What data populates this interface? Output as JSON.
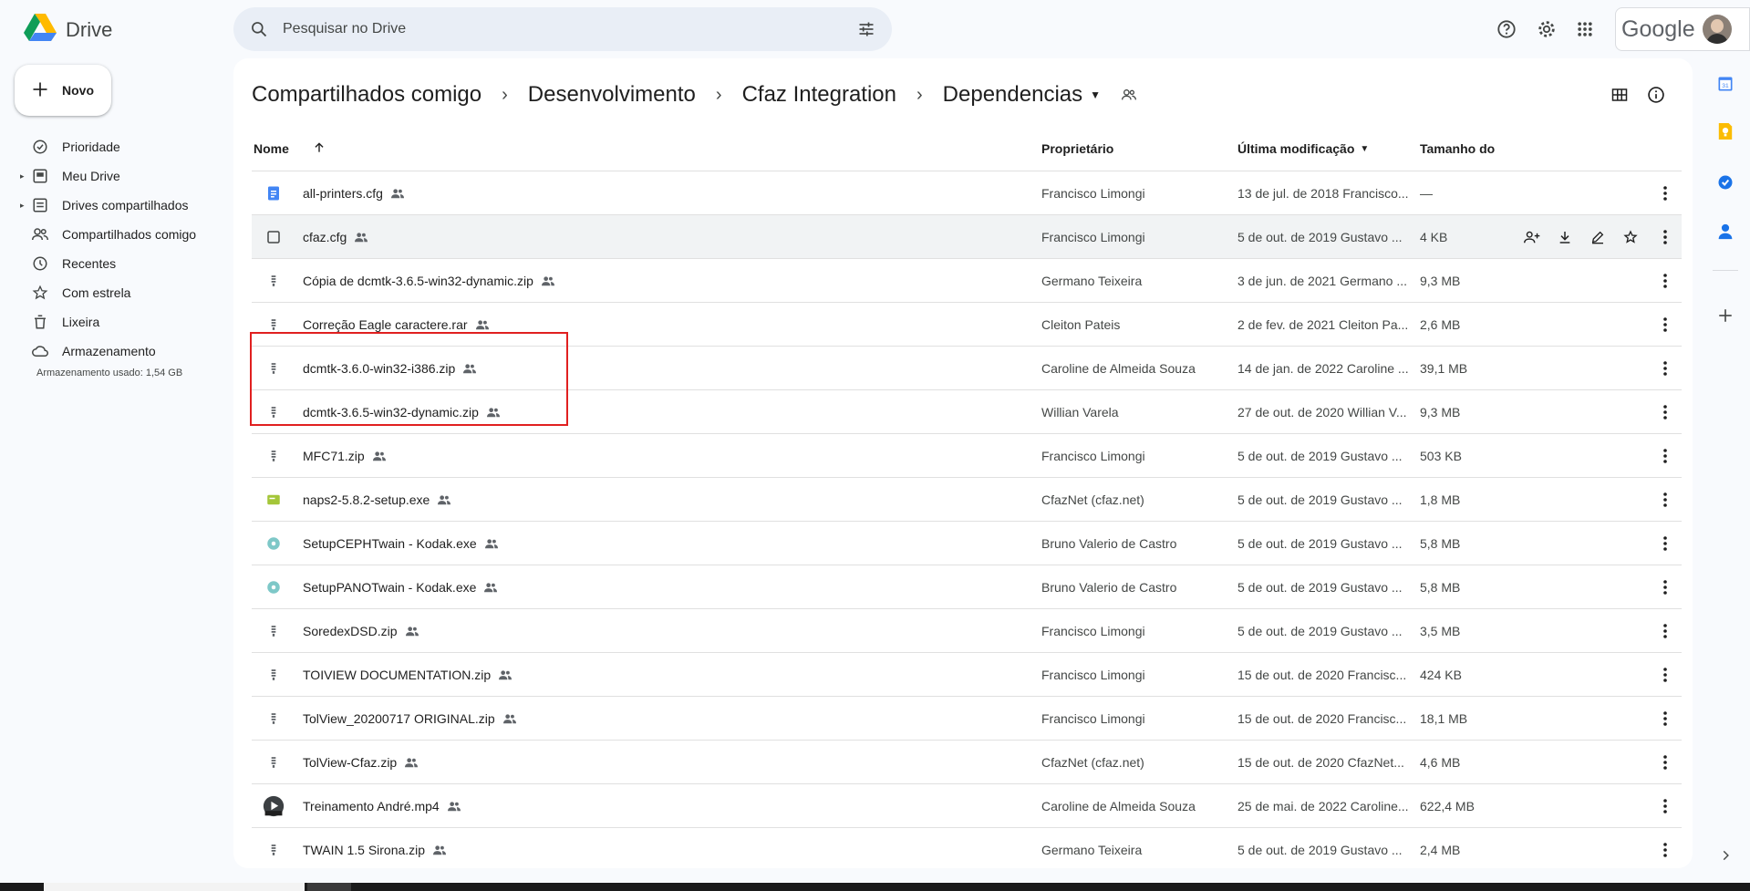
{
  "app": {
    "name": "Drive"
  },
  "search": {
    "placeholder": "Pesquisar no Drive"
  },
  "account": {
    "brand": "Google"
  },
  "sidebar": {
    "new_label": "Novo",
    "items": [
      {
        "label": "Prioridade",
        "icon": "priority-icon",
        "caret": false
      },
      {
        "label": "Meu Drive",
        "icon": "my-drive-icon",
        "caret": true
      },
      {
        "label": "Drives compartilhados",
        "icon": "shared-drives-icon",
        "caret": true
      },
      {
        "label": "Compartilhados comigo",
        "icon": "shared-with-me-icon",
        "caret": false
      },
      {
        "label": "Recentes",
        "icon": "clock-icon",
        "caret": false
      },
      {
        "label": "Com estrela",
        "icon": "star-icon",
        "caret": false
      },
      {
        "label": "Lixeira",
        "icon": "trash-icon",
        "caret": false
      },
      {
        "label": "Armazenamento",
        "icon": "cloud-icon",
        "caret": false
      }
    ],
    "storage_text": "Armazenamento usado: 1,54 GB"
  },
  "breadcrumb": [
    "Compartilhados comigo",
    "Desenvolvimento",
    "Cfaz Integration",
    "Dependencias"
  ],
  "table": {
    "headers": {
      "name": "Nome",
      "owner": "Proprietário",
      "modified": "Última modificação",
      "size": "Tamanho do"
    },
    "rows": [
      {
        "name": "all-printers.cfg",
        "icon": "doc-icon",
        "owner": "Francisco Limongi",
        "modified": "13 de jul. de 2018 Francisco...",
        "size": "—"
      },
      {
        "name": "cfaz.cfg",
        "icon": "checkbox-icon",
        "owner": "Francisco Limongi",
        "modified": "5 de out. de 2019 Gustavo ...",
        "size": "4 KB"
      },
      {
        "name": "Cópia de dcmtk-3.6.5-win32-dynamic.zip",
        "icon": "zip-icon",
        "owner": "Germano Teixeira",
        "modified": "3 de jun. de 2021 Germano ...",
        "size": "9,3 MB"
      },
      {
        "name": "Correção Eagle caractere.rar",
        "icon": "zip-icon",
        "owner": "Cleiton Pateis",
        "modified": "2 de fev. de 2021 Cleiton Pa...",
        "size": "2,6 MB"
      },
      {
        "name": "dcmtk-3.6.0-win32-i386.zip",
        "icon": "zip-icon",
        "owner": "Caroline de Almeida Souza",
        "modified": "14 de jan. de 2022 Caroline ...",
        "size": "39,1 MB"
      },
      {
        "name": "dcmtk-3.6.5-win32-dynamic.zip",
        "icon": "zip-icon",
        "owner": "Willian Varela",
        "modified": "27 de out. de 2020 Willian V...",
        "size": "9,3 MB"
      },
      {
        "name": "MFC71.zip",
        "icon": "zip-icon",
        "owner": "Francisco Limongi",
        "modified": "5 de out. de 2019 Gustavo ...",
        "size": "503 KB"
      },
      {
        "name": "naps2-5.8.2-setup.exe",
        "icon": "exe-icon",
        "owner": "CfazNet (cfaz.net)",
        "modified": "5 de out. de 2019 Gustavo ...",
        "size": "1,8 MB"
      },
      {
        "name": "SetupCEPHTwain - Kodak.exe",
        "icon": "disc-icon",
        "owner": "Bruno Valerio de Castro",
        "modified": "5 de out. de 2019 Gustavo ...",
        "size": "5,8 MB"
      },
      {
        "name": "SetupPANOTwain - Kodak.exe",
        "icon": "disc-icon",
        "owner": "Bruno Valerio de Castro",
        "modified": "5 de out. de 2019 Gustavo ...",
        "size": "5,8 MB"
      },
      {
        "name": "SoredexDSD.zip",
        "icon": "zip-icon",
        "owner": "Francisco Limongi",
        "modified": "5 de out. de 2019 Gustavo ...",
        "size": "3,5 MB"
      },
      {
        "name": "TOIVIEW DOCUMENTATION.zip",
        "icon": "zip-icon",
        "owner": "Francisco Limongi",
        "modified": "15 de out. de 2020 Francisc...",
        "size": "424 KB"
      },
      {
        "name": "TolView_20200717 ORIGINAL.zip",
        "icon": "zip-icon",
        "owner": "Francisco Limongi",
        "modified": "15 de out. de 2020 Francisc...",
        "size": "18,1 MB"
      },
      {
        "name": "TolView-Cfaz.zip",
        "icon": "zip-icon",
        "owner": "CfazNet (cfaz.net)",
        "modified": "15 de out. de 2020 CfazNet...",
        "size": "4,6 MB"
      },
      {
        "name": "Treinamento André.mp4",
        "icon": "video-icon",
        "owner": "Caroline de Almeida Souza",
        "modified": "25 de mai. de 2022 Caroline...",
        "size": "622,4 MB"
      },
      {
        "name": "TWAIN 1.5 Sirona.zip",
        "icon": "zip-icon",
        "owner": "Germano Teixeira",
        "modified": "5 de out. de 2019 Gustavo ...",
        "size": "2,4 MB"
      }
    ]
  },
  "colors": {
    "accent": "#0b57d0",
    "highlight_box": "#e02020",
    "background": "#f8fafd"
  }
}
